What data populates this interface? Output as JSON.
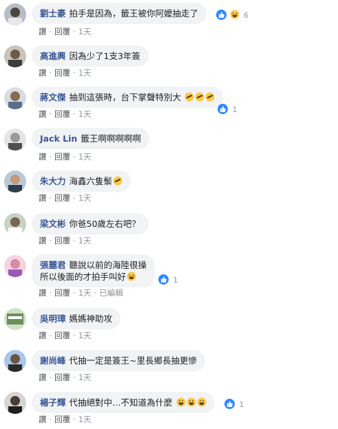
{
  "colors": {
    "name": "#385898",
    "bubble": "#f2f3f5",
    "meta": "#90949c",
    "like": "#2d88ff"
  },
  "actions": {
    "like": "讚",
    "reply": "回覆",
    "edited": "已編輯"
  },
  "comments": [
    {
      "name": "劉士豪",
      "text": "拍手是因為，籤王被你阿嬤抽走了",
      "time": "1天",
      "reactions": "6"
    },
    {
      "name": "高進興",
      "text": "因為少了1支3年簽",
      "time": "1天"
    },
    {
      "name": "蔣文傑",
      "text": "抽到這張時，台下掌聲特別大",
      "time": "1天",
      "reactions": "1"
    },
    {
      "name": "Jack Lin",
      "text": "籤王啊啊啊啊啊",
      "time": "1天"
    },
    {
      "name": "朱大力",
      "text": "海鑫六隻鬃",
      "time": "1天"
    },
    {
      "name": "梁文彬",
      "text": "你爸50歲左右吧？",
      "time": "1天"
    },
    {
      "name": "張麗君",
      "text": "聽說以前的海陸很操",
      "text2": "所以後面的才拍手叫好",
      "time": "1天",
      "reactions": "1"
    },
    {
      "name": "吳明璋",
      "text": "媽媽神助攻",
      "time": "1天"
    },
    {
      "name": "謝尚峰",
      "text": "代抽一定是簽王~里長鄉長抽更慘",
      "time": "1天"
    },
    {
      "name": "楊子輝",
      "text": "代抽絕對中…不知道為什麼",
      "time": "1天",
      "reactions": "1"
    }
  ]
}
